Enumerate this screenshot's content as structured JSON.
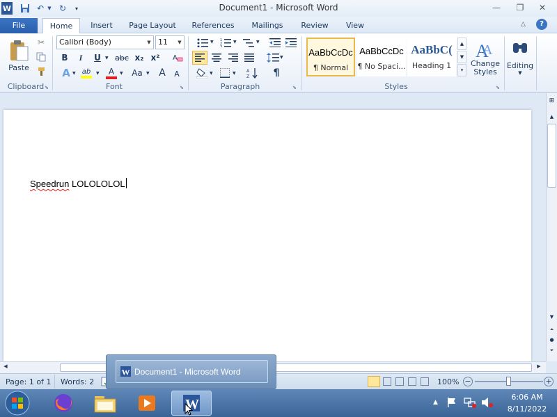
{
  "window": {
    "title": "Document1 - Microsoft Word"
  },
  "tabs": [
    "File",
    "Home",
    "Insert",
    "Page Layout",
    "References",
    "Mailings",
    "Review",
    "View"
  ],
  "ribbon": {
    "clipboard": {
      "paste_label": "Paste",
      "group_label": "Clipboard"
    },
    "font": {
      "family": "Calibri (Body)",
      "size": "11",
      "group_label": "Font",
      "bold": "B",
      "italic": "I",
      "underline": "U",
      "strike": "abc",
      "subscript": "x₂",
      "superscript": "x²",
      "grow": "A",
      "changecase": "Aa"
    },
    "paragraph": {
      "group_label": "Paragraph",
      "show_marks": "¶"
    },
    "styles": {
      "group_label": "Styles",
      "items": [
        {
          "sample": "AaBbCcDc",
          "name": "¶ Normal"
        },
        {
          "sample": "AaBbCcDc",
          "name": "¶ No Spaci..."
        },
        {
          "sample": "AaBbC(",
          "name": "Heading 1"
        }
      ],
      "change_styles_line1": "Change",
      "change_styles_line2": "Styles"
    },
    "editing_label": "Editing"
  },
  "document": {
    "word1": "Speedrun",
    "word2": " LOLOLOLOL"
  },
  "status": {
    "page": "Page: 1 of 1",
    "words": "Words: 2",
    "zoom": "100%"
  },
  "taskbar": {
    "popup_title": "Document1 - Microsoft Word",
    "time": "6:06 AM",
    "date": "8/11/2022"
  },
  "colors": {
    "file_tab": "#2a5fab",
    "taskbar": "#3a6496",
    "word_blue": "#2b579a"
  }
}
